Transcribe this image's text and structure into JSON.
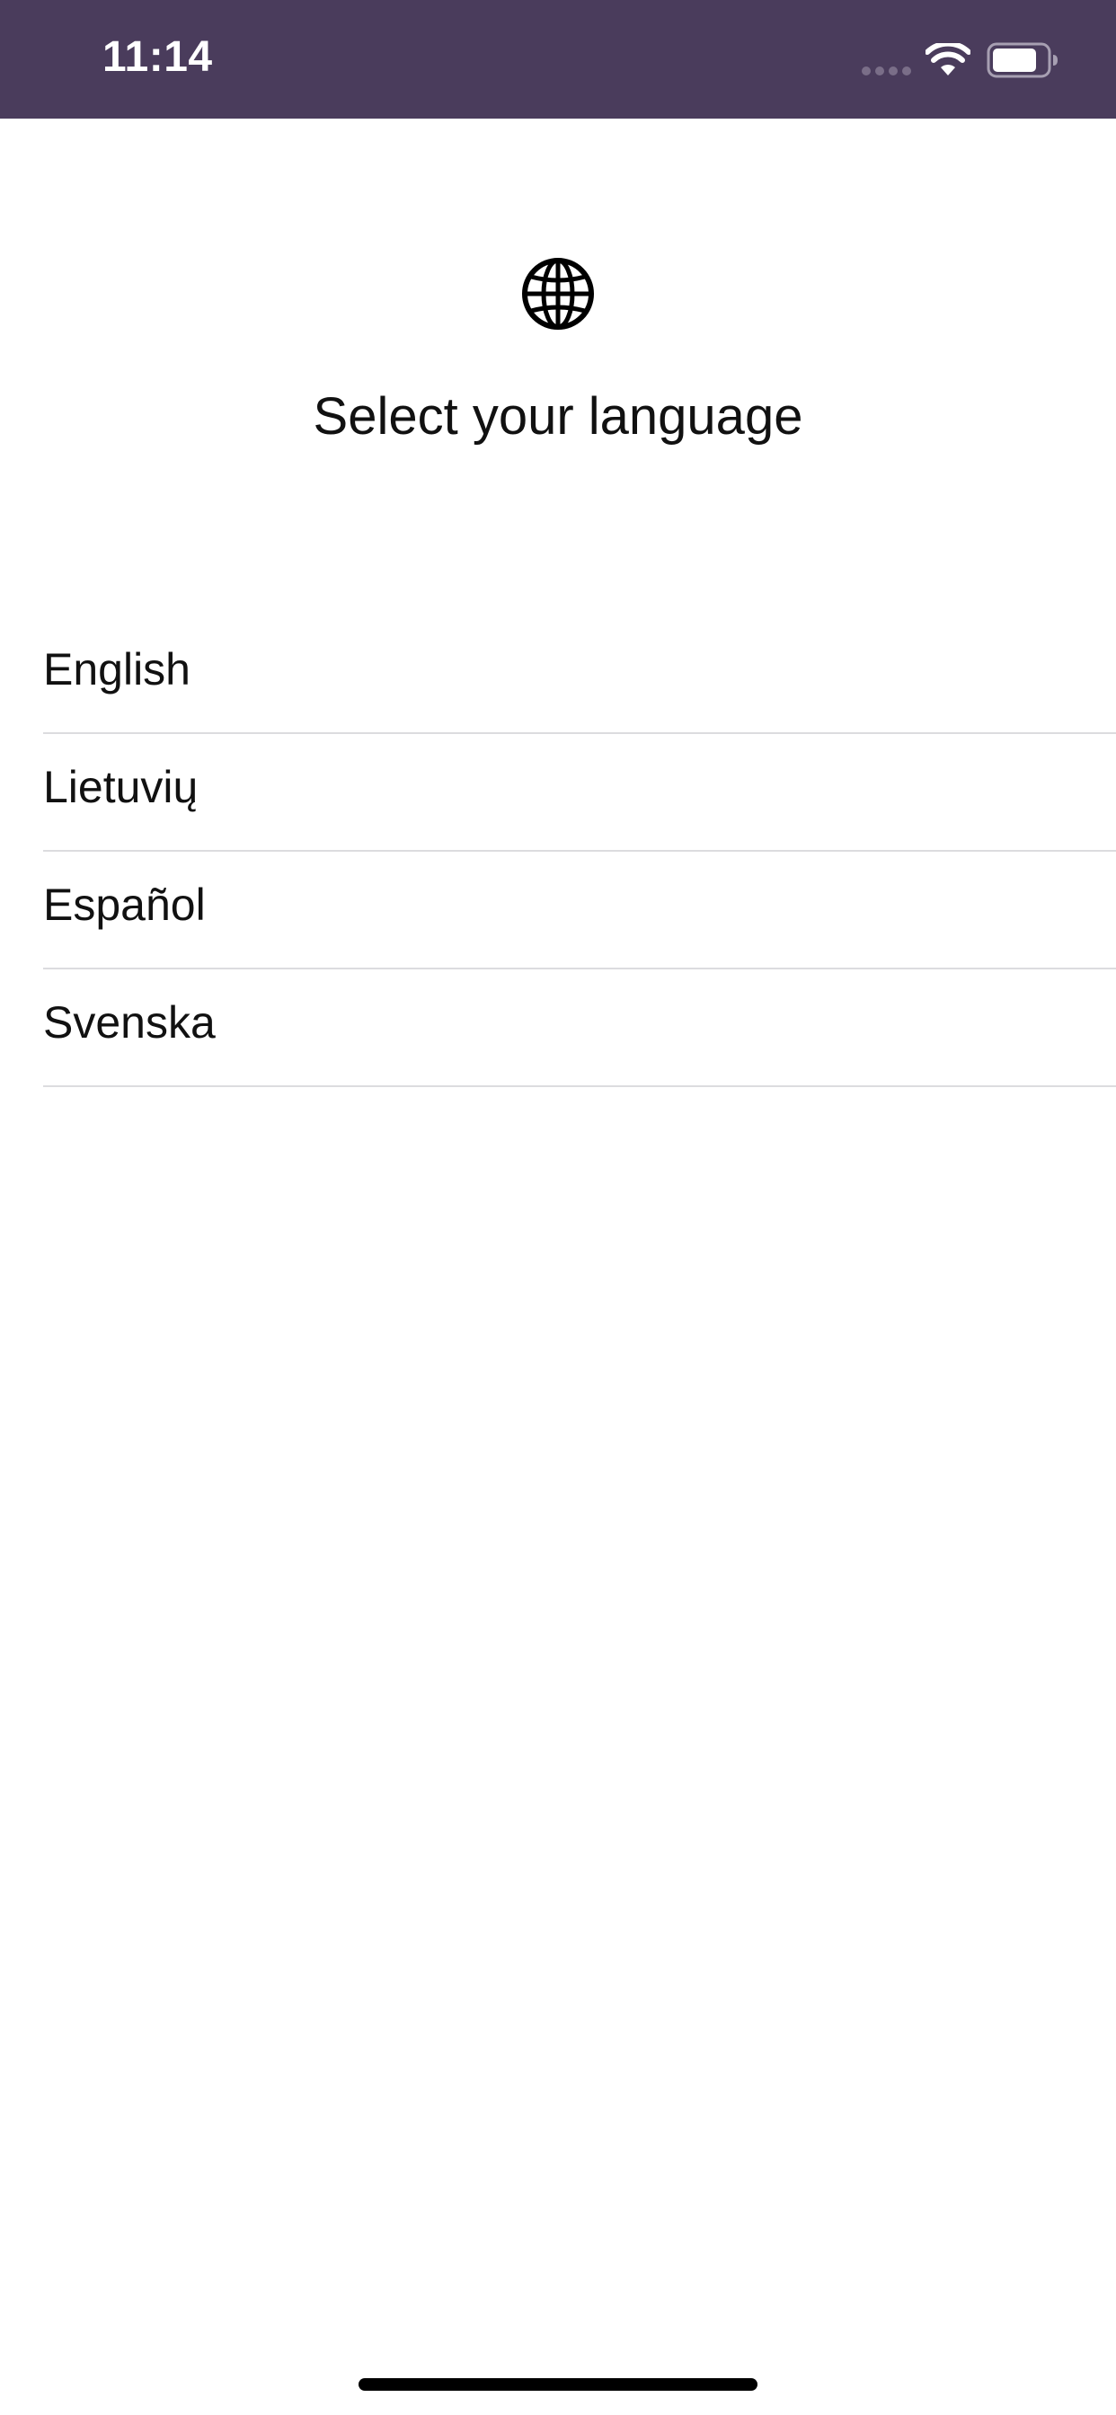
{
  "status_bar": {
    "time": "11:14",
    "background_color": "#4a3c5c",
    "icons": [
      "signal-dots-icon",
      "wifi-icon",
      "battery-icon"
    ]
  },
  "header": {
    "icon": "globe-icon",
    "title": "Select your language"
  },
  "languages": [
    {
      "label": "English"
    },
    {
      "label": "Lietuvių"
    },
    {
      "label": "Español"
    },
    {
      "label": "Svenska"
    }
  ]
}
